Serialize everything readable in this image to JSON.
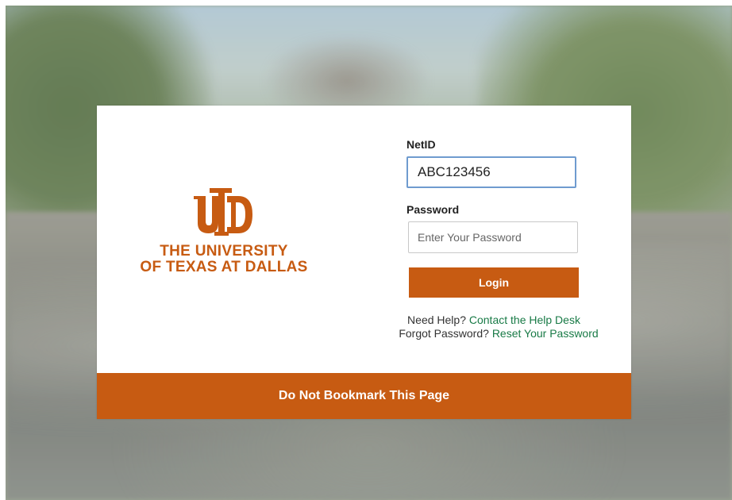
{
  "brand": {
    "name_line1": "THE UNIVERSITY",
    "name_line2": "OF TEXAS AT DALLAS",
    "logo_mark": "UTD",
    "color": "#c75b12"
  },
  "login_form": {
    "netid_label": "NetID",
    "netid_value": "ABC123456",
    "password_label": "Password",
    "password_placeholder": "Enter Your Password",
    "login_label": "Login"
  },
  "help": {
    "need_help_text": "Need Help?",
    "contact_link": "Contact the Help Desk",
    "forgot_text": "Forgot Password?",
    "reset_link": "Reset Your Password",
    "link_color": "#187a46"
  },
  "footer": {
    "notice": "Do Not Bookmark This Page"
  }
}
